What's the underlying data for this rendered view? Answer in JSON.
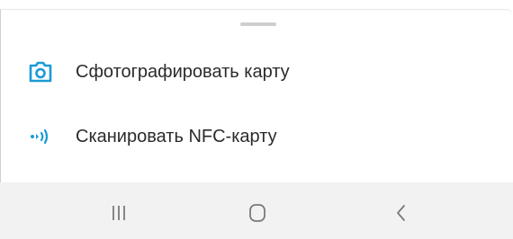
{
  "bottom_sheet": {
    "actions": [
      {
        "label": "Сфотографировать карту",
        "icon": "camera-icon"
      },
      {
        "label": "Сканировать NFC-карту",
        "icon": "nfc-icon"
      }
    ]
  },
  "nav_bar": {
    "buttons": [
      {
        "icon": "recents-icon"
      },
      {
        "icon": "home-icon"
      },
      {
        "icon": "back-icon"
      }
    ]
  },
  "colors": {
    "accent": "#1a9ad6",
    "text": "#2b2b2b",
    "nav_background": "#f2f2f2",
    "nav_icon": "#7a7a7a"
  }
}
